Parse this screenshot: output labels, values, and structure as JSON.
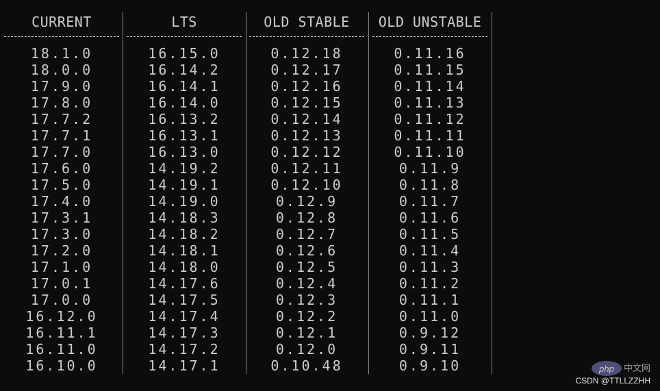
{
  "columns": [
    {
      "header": "CURRENT",
      "versions": [
        "18.1.0",
        "18.0.0",
        "17.9.0",
        "17.8.0",
        "17.7.2",
        "17.7.1",
        "17.7.0",
        "17.6.0",
        "17.5.0",
        "17.4.0",
        "17.3.1",
        "17.3.0",
        "17.2.0",
        "17.1.0",
        "17.0.1",
        "17.0.0",
        "16.12.0",
        "16.11.1",
        "16.11.0",
        "16.10.0"
      ]
    },
    {
      "header": "LTS",
      "versions": [
        "16.15.0",
        "16.14.2",
        "16.14.1",
        "16.14.0",
        "16.13.2",
        "16.13.1",
        "16.13.0",
        "14.19.2",
        "14.19.1",
        "14.19.0",
        "14.18.3",
        "14.18.2",
        "14.18.1",
        "14.18.0",
        "14.17.6",
        "14.17.5",
        "14.17.4",
        "14.17.3",
        "14.17.2",
        "14.17.1"
      ]
    },
    {
      "header": "OLD STABLE",
      "versions": [
        "0.12.18",
        "0.12.17",
        "0.12.16",
        "0.12.15",
        "0.12.14",
        "0.12.13",
        "0.12.12",
        "0.12.11",
        "0.12.10",
        "0.12.9",
        "0.12.8",
        "0.12.7",
        "0.12.6",
        "0.12.5",
        "0.12.4",
        "0.12.3",
        "0.12.2",
        "0.12.1",
        "0.12.0",
        "0.10.48"
      ]
    },
    {
      "header": "OLD UNSTABLE",
      "versions": [
        "0.11.16",
        "0.11.15",
        "0.11.14",
        "0.11.13",
        "0.11.12",
        "0.11.11",
        "0.11.10",
        "0.11.9",
        "0.11.8",
        "0.11.7",
        "0.11.6",
        "0.11.5",
        "0.11.4",
        "0.11.3",
        "0.11.2",
        "0.11.1",
        "0.11.0",
        "0.9.12",
        "0.9.11",
        "0.9.10"
      ]
    }
  ],
  "watermark": {
    "logo_text": "php",
    "site_text": "中文网",
    "credit": "CSDN @TTLLZZHH"
  }
}
